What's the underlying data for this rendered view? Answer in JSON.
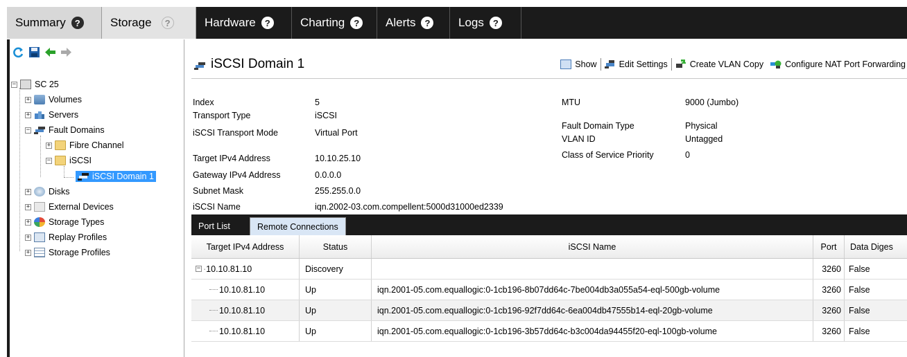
{
  "tabs": [
    {
      "label": "Summary",
      "active": false
    },
    {
      "label": "Storage",
      "active": true
    },
    {
      "label": "Hardware",
      "active": false
    },
    {
      "label": "Charting",
      "active": false
    },
    {
      "label": "Alerts",
      "active": false
    },
    {
      "label": "Logs",
      "active": false
    }
  ],
  "tree": {
    "root": "SC 25",
    "items": {
      "volumes": "Volumes",
      "servers": "Servers",
      "fault_domains": "Fault Domains",
      "fibre_channel": "Fibre Channel",
      "iscsi": "iSCSI",
      "iscsi_domain_1": "iSCSI Domain 1",
      "disks": "Disks",
      "external_devices": "External Devices",
      "storage_types": "Storage Types",
      "replay_profiles": "Replay Profiles",
      "storage_profiles": "Storage Profiles"
    }
  },
  "domain": {
    "title": "iSCSI Domain 1",
    "actions": {
      "show": "Show",
      "edit_settings": "Edit Settings",
      "create_vlan_copy": "Create VLAN Copy",
      "configure_nat": "Configure NAT Port Forwarding"
    },
    "props_left": [
      {
        "label": "Index",
        "value": "5"
      },
      {
        "label": "Transport Type",
        "value": "iSCSI"
      },
      {
        "label": "iSCSI Transport Mode",
        "value": "Virtual Port"
      },
      {
        "label": "Target IPv4 Address",
        "value": "10.10.25.10"
      },
      {
        "label": "Gateway IPv4 Address",
        "value": "0.0.0.0"
      },
      {
        "label": "Subnet Mask",
        "value": "255.255.0.0"
      },
      {
        "label": "iSCSI Name",
        "value": "iqn.2002-03.com.compellent:5000d31000ed2339"
      }
    ],
    "props_right": [
      {
        "label": "MTU",
        "value": "9000 (Jumbo)"
      },
      {
        "label": "Fault Domain Type",
        "value": "Physical"
      },
      {
        "label": "VLAN ID",
        "value": "Untagged"
      },
      {
        "label": "Class of Service Priority",
        "value": "0"
      }
    ]
  },
  "subtabs": {
    "port_list": "Port List",
    "remote_connections": "Remote Connections"
  },
  "table": {
    "headers": {
      "target": "Target IPv4 Address",
      "status": "Status",
      "iscsi_name": "iSCSI Name",
      "port": "Port",
      "digest": "Data Diges"
    },
    "rows": [
      {
        "target": "10.10.81.10",
        "status": "Discovery",
        "iscsi_name": "",
        "port": "3260",
        "digest": "False"
      },
      {
        "target": "10.10.81.10",
        "status": "Up",
        "iscsi_name": "iqn.2001-05.com.equallogic:0-1cb196-8b07dd64c-7be004db3a055a54-eql-500gb-volume",
        "port": "3260",
        "digest": "False"
      },
      {
        "target": "10.10.81.10",
        "status": "Up",
        "iscsi_name": "iqn.2001-05.com.equallogic:0-1cb196-92f7dd64c-6ea004db47555b14-eql-20gb-volume",
        "port": "3260",
        "digest": "False"
      },
      {
        "target": "10.10.81.10",
        "status": "Up",
        "iscsi_name": "iqn.2001-05.com.equallogic:0-1cb196-3b57dd64c-b3c004da94455f20-eql-100gb-volume",
        "port": "3260",
        "digest": "False"
      }
    ]
  }
}
